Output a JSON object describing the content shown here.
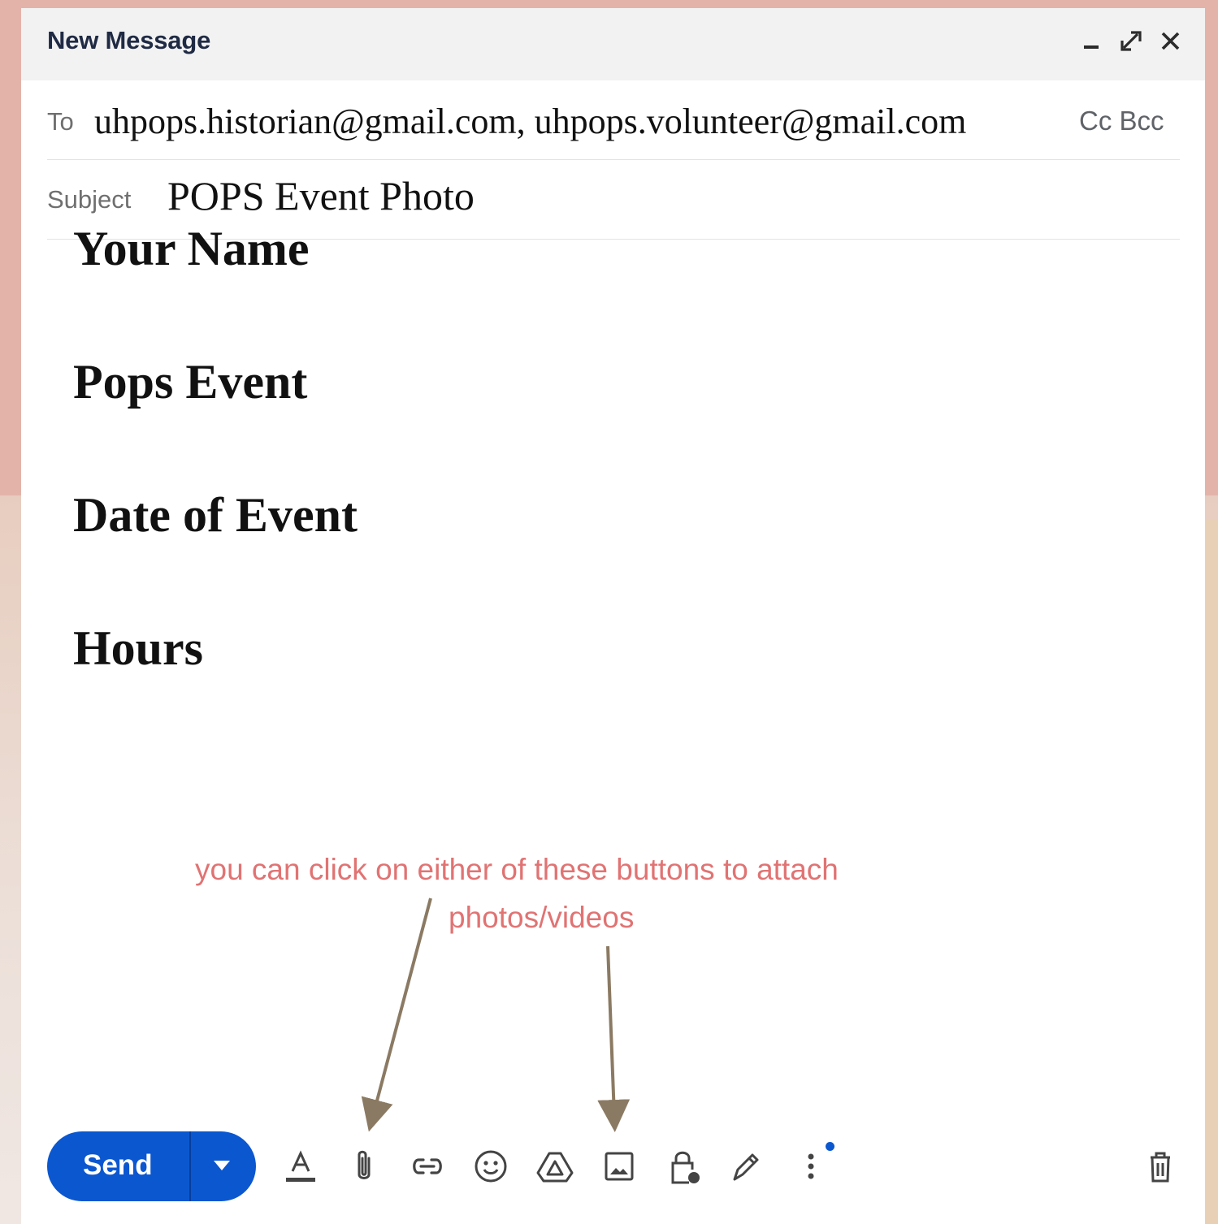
{
  "window": {
    "title": "New Message"
  },
  "recipients": {
    "label": "To",
    "value": "uhpops.historian@gmail.com, uhpops.volunteer@gmail.com",
    "cc_bcc": "Cc Bcc"
  },
  "subject": {
    "label": "Subject",
    "value": "POPS Event Photo"
  },
  "body": {
    "lines": [
      "Your Name",
      "Pops Event",
      "Date of Event",
      "Hours"
    ]
  },
  "annotation": {
    "line1": "you can click on either of these buttons to attach",
    "line2": "photos/videos",
    "color": "#e17373",
    "arrow_color": "#8b7a63"
  },
  "toolbar": {
    "send_label": "Send",
    "icons": [
      "format-text-icon",
      "attach-file-icon",
      "insert-link-icon",
      "emoji-icon",
      "google-drive-icon",
      "insert-photo-icon",
      "confidential-mode-icon",
      "signature-icon",
      "more-options-icon",
      "discard-trash-icon"
    ]
  },
  "colors": {
    "send": "#0b57d0",
    "title": "#1f2a44"
  }
}
